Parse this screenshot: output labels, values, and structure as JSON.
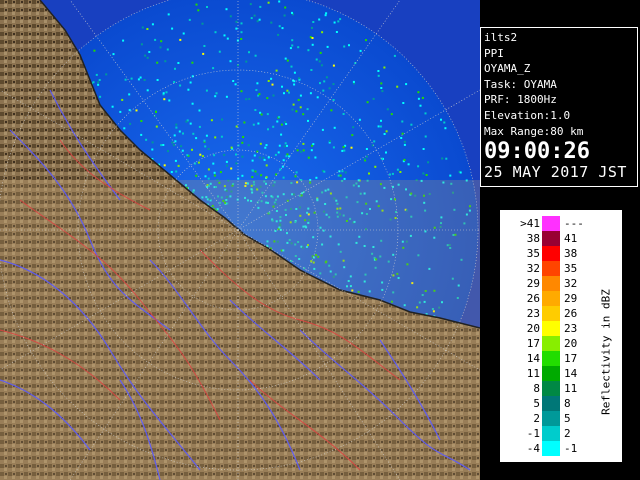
{
  "info": {
    "lines": [
      "ilts2",
      "PPI",
      "OYAMA_Z",
      "Task: OYAMA",
      "PRF: 1800Hz",
      "Elevation:1.0",
      "Max Range:80 km"
    ],
    "time": "09:00:26",
    "date": "25 MAY 2017 JST"
  },
  "legend": {
    "title": "Reflectivity in dBZ",
    "rows": [
      {
        "lo": ">41",
        "hi": "---",
        "color": "#ff30ff"
      },
      {
        "lo": "38",
        "hi": "41",
        "color": "#990033"
      },
      {
        "lo": "35",
        "hi": "38",
        "color": "#ff0000"
      },
      {
        "lo": "32",
        "hi": "35",
        "color": "#ff4400"
      },
      {
        "lo": "29",
        "hi": "32",
        "color": "#ff8800"
      },
      {
        "lo": "26",
        "hi": "29",
        "color": "#ffaa00"
      },
      {
        "lo": "23",
        "hi": "26",
        "color": "#ffcc00"
      },
      {
        "lo": "20",
        "hi": "23",
        "color": "#ffff00"
      },
      {
        "lo": "17",
        "hi": "20",
        "color": "#88ee00"
      },
      {
        "lo": "14",
        "hi": "17",
        "color": "#22dd00"
      },
      {
        "lo": "11",
        "hi": "14",
        "color": "#00aa00"
      },
      {
        "lo": "8",
        "hi": "11",
        "color": "#008844"
      },
      {
        "lo": "5",
        "hi": "8",
        "color": "#007777"
      },
      {
        "lo": "2",
        "hi": "5",
        "color": "#009999"
      },
      {
        "lo": "-1",
        "hi": "2",
        "color": "#00cccc"
      },
      {
        "lo": "-4",
        "hi": "-1",
        "color": "#00ffff"
      }
    ]
  },
  "colors": {
    "sea_echo": "#1060e0",
    "land": "#8c7350",
    "land_dark": "#4a3a22",
    "rivers": "#5a5aff",
    "boundaries": "#e04040",
    "range_rings": "#d0d0d0"
  }
}
